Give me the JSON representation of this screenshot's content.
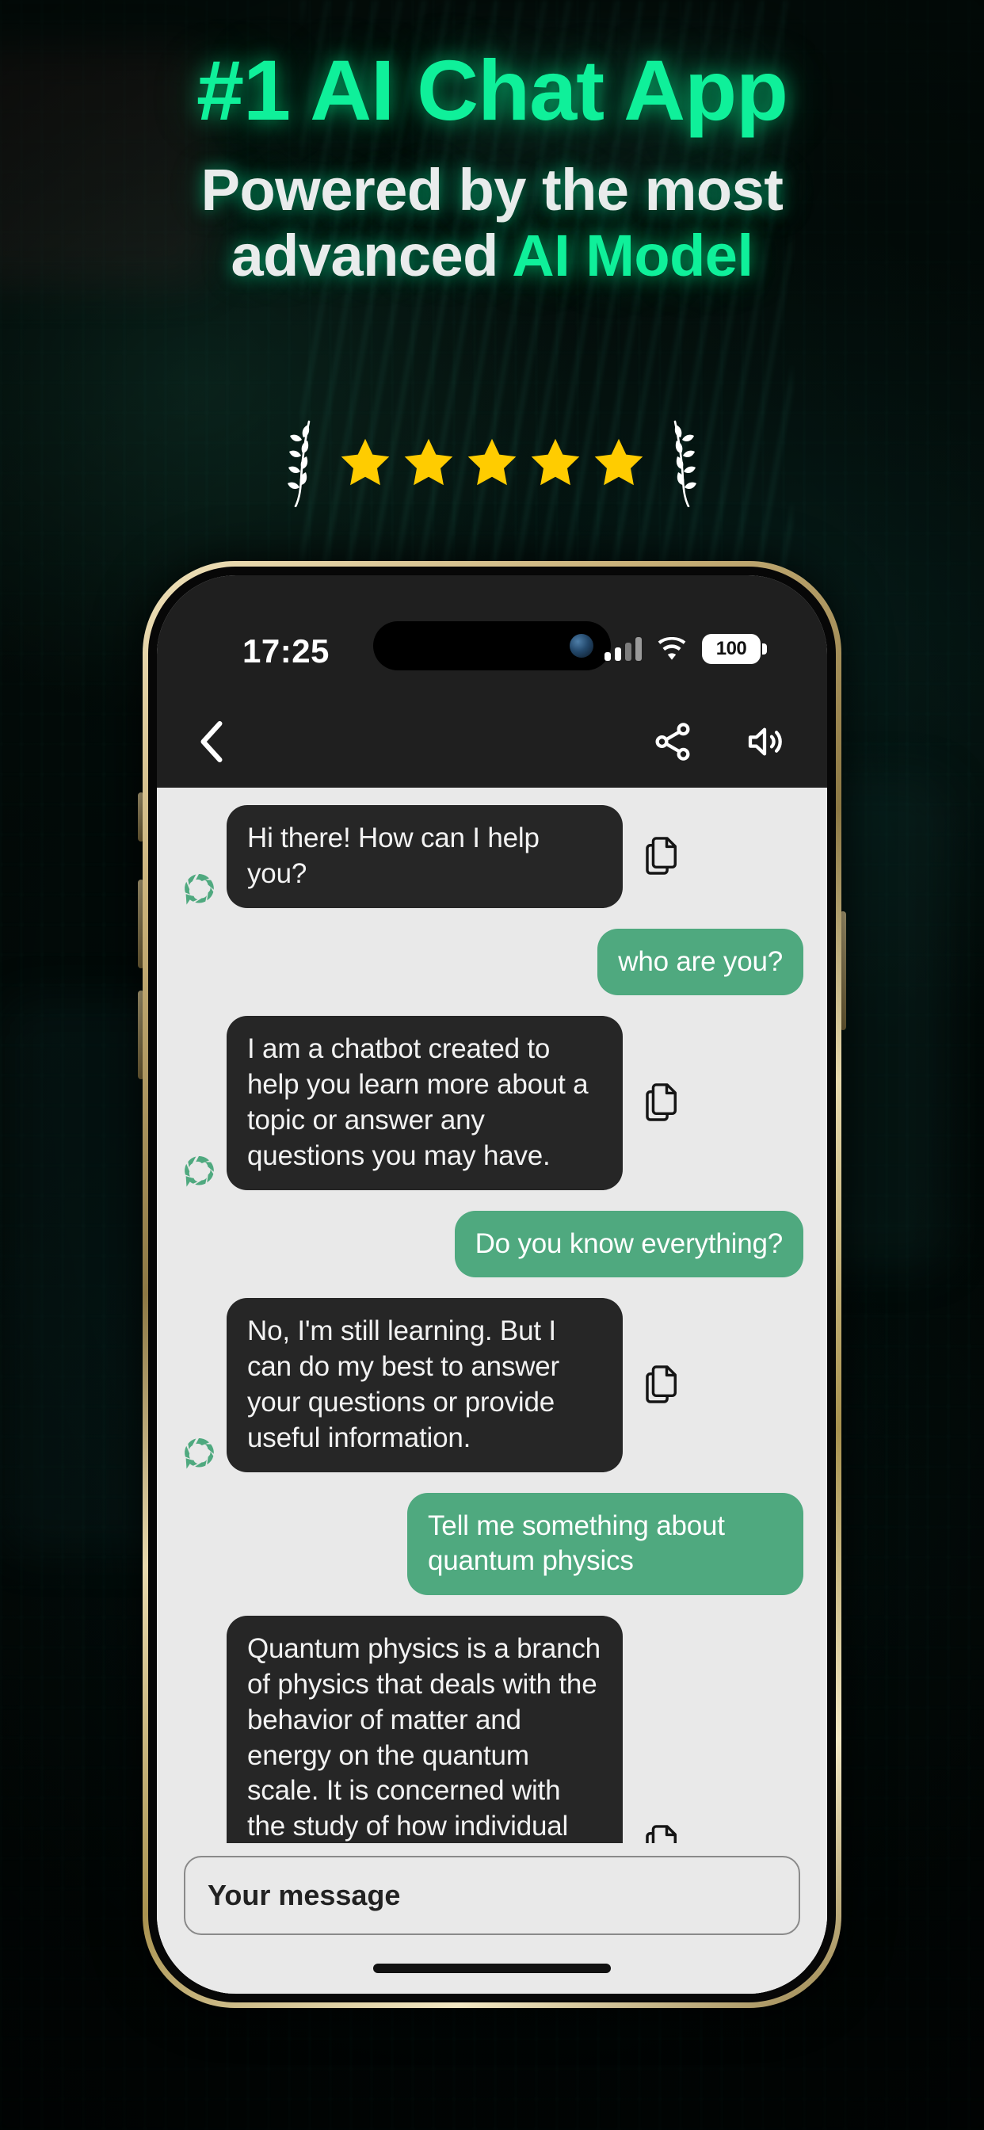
{
  "promo": {
    "title": "#1 AI Chat App",
    "subtitle_line1": "Powered by the most",
    "subtitle_line2_plain": "advanced ",
    "subtitle_line2_accent": "AI Model",
    "accent_color": "#0ff09a",
    "white_color": "#e9ecec",
    "star_color": "#FFCC00",
    "star_count": 5,
    "laurel_color": "#ffffff"
  },
  "status_bar": {
    "time": "17:25",
    "battery_level": "100",
    "signal_icon": "cellular-bars-icon",
    "wifi_icon": "wifi-icon",
    "battery_icon": "battery-icon",
    "camera_icon": "front-camera-icon"
  },
  "app_nav": {
    "back_icon": "chevron-left-icon",
    "share_icon": "share-icon",
    "speaker_icon": "speaker-volume-icon"
  },
  "chat": {
    "avatar_icon": "bot-aperture-avatar-icon",
    "copy_icon": "copy-icon",
    "bot_bubble_color": "#262626",
    "user_bubble_color": "#4fa97f",
    "messages": [
      {
        "sender": "bot",
        "text": "Hi there! How can I help you?"
      },
      {
        "sender": "user",
        "text": "who are you?"
      },
      {
        "sender": "bot",
        "text": "I am a chatbot created to help you learn more about a topic or answer any questions you may have."
      },
      {
        "sender": "user",
        "text": "Do you know everything?"
      },
      {
        "sender": "bot",
        "text": "No, I'm still learning. But I can do my best to answer your questions or provide useful information."
      },
      {
        "sender": "user",
        "text": "Tell me something about quantum physics"
      },
      {
        "sender": "bot",
        "text": "Quantum physics is a branch of physics that deals with the behavior of matter and energy on the quantum scale. It is concerned with the study of how individual particles interact with each other, as well as with electromagnetic fields, to create the physical phenomena we observe in the world around us."
      }
    ]
  },
  "composer": {
    "placeholder": "Your message"
  }
}
